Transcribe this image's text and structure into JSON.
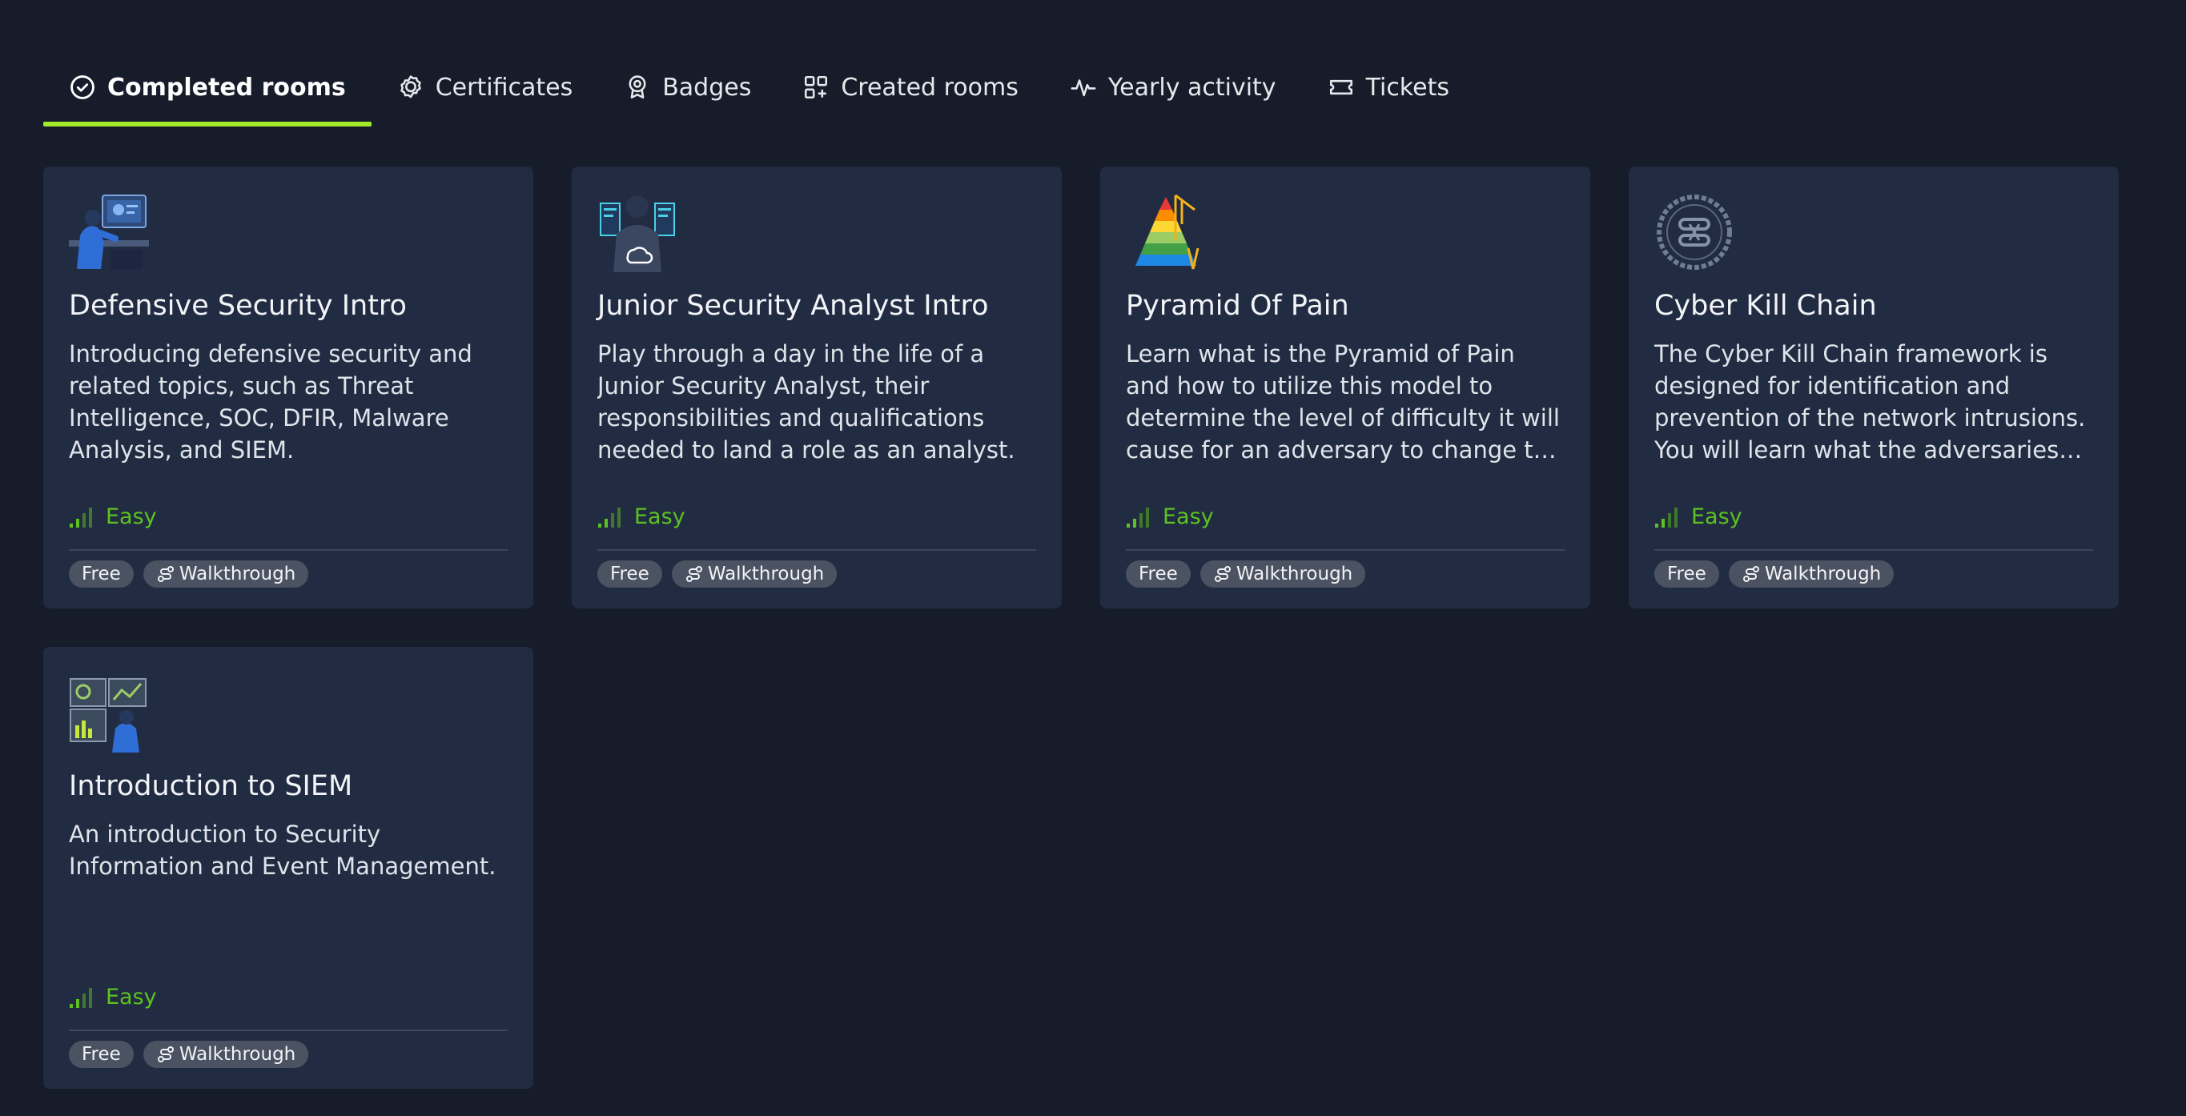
{
  "tabs": [
    {
      "label": "Completed rooms",
      "icon": "check-circle-icon",
      "active": true
    },
    {
      "label": "Certificates",
      "icon": "certificate-icon",
      "active": false
    },
    {
      "label": "Badges",
      "icon": "badge-icon",
      "active": false
    },
    {
      "label": "Created rooms",
      "icon": "grid-plus-icon",
      "active": false
    },
    {
      "label": "Yearly activity",
      "icon": "activity-icon",
      "active": false
    },
    {
      "label": "Tickets",
      "icon": "ticket-icon",
      "active": false
    }
  ],
  "colors": {
    "background": "#171c2b",
    "card": "#212c42",
    "accent": "#a3ea2a",
    "difficulty_easy": "#5dc221",
    "pill": "#4b5262"
  },
  "rooms": [
    {
      "title": "Defensive Security Intro",
      "description": "Introducing defensive security and related topics, such as Threat Intelligence, SOC, DFIR, Malware Analysis, and SIEM.",
      "difficulty": "Easy",
      "tags": [
        "Free",
        "Walkthrough"
      ],
      "thumbnail": "analyst-desk-illustration"
    },
    {
      "title": "Junior Security Analyst Intro",
      "description": "Play through a day in the life of a Junior Security Analyst, their responsibilities and qualifications needed to land a role as an analyst.",
      "difficulty": "Easy",
      "tags": [
        "Free",
        "Walkthrough"
      ],
      "thumbnail": "analyst-monitors-illustration"
    },
    {
      "title": "Pyramid Of Pain",
      "description": "Learn what is the Pyramid of Pain and how to utilize this model to determine the level of difficulty it will cause for an adversary to change the indicators associated with them.",
      "difficulty": "Easy",
      "tags": [
        "Free",
        "Walkthrough"
      ],
      "thumbnail": "pyramid-illustration"
    },
    {
      "title": "Cyber Kill Chain",
      "description": "The Cyber Kill Chain framework is designed for identification and prevention of the network intrusions. You will learn what the adversaries need to do in order to achieve their goals.",
      "difficulty": "Easy",
      "tags": [
        "Free",
        "Walkthrough"
      ],
      "thumbnail": "chain-circle-illustration"
    },
    {
      "title": "Introduction to SIEM",
      "description": "An introduction to Security Information and Event Management.",
      "difficulty": "Easy",
      "tags": [
        "Free",
        "Walkthrough"
      ],
      "thumbnail": "siem-dashboard-illustration"
    }
  ]
}
